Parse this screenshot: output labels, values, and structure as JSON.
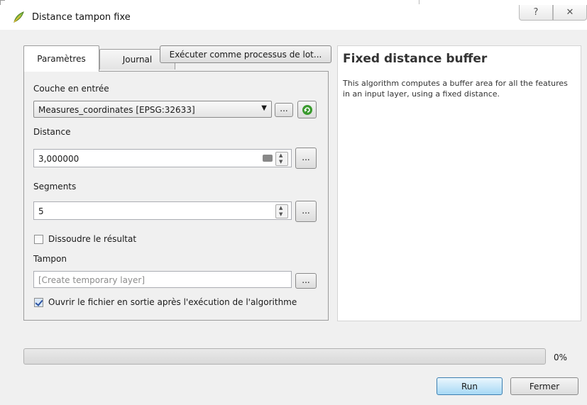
{
  "window": {
    "title": "Distance tampon fixe",
    "help_btn": "?",
    "close_btn": "✕"
  },
  "tabs": [
    {
      "label": "Paramètres",
      "active": true
    },
    {
      "label": "Journal",
      "active": false
    }
  ],
  "batch_button": "Exécuter comme processus de lot...",
  "form": {
    "input_layer_label": "Couche en entrée",
    "input_layer_value": "Measures_coordinates [EPSG:32633]",
    "distance_label": "Distance",
    "distance_value": "3,000000",
    "segments_label": "Segments",
    "segments_value": "5",
    "dissolve_label": "Dissoudre le résultat",
    "dissolve_checked": false,
    "output_label": "Tampon",
    "output_placeholder": "[Create temporary layer]",
    "open_output_label": "Ouvrir le fichier en sortie après l'exécution de l'algorithme",
    "open_output_checked": true,
    "dots": "..."
  },
  "help": {
    "title": "Fixed distance buffer",
    "text": "This algorithm computes a buffer area for all the features in an input layer, using a fixed distance."
  },
  "progress": {
    "value_percent": 0,
    "label": "0%"
  },
  "buttons": {
    "run": "Run",
    "close": "Fermer"
  },
  "colors": {
    "run_border": "#3c7fb1",
    "accent_green": "#3a9a2e"
  }
}
